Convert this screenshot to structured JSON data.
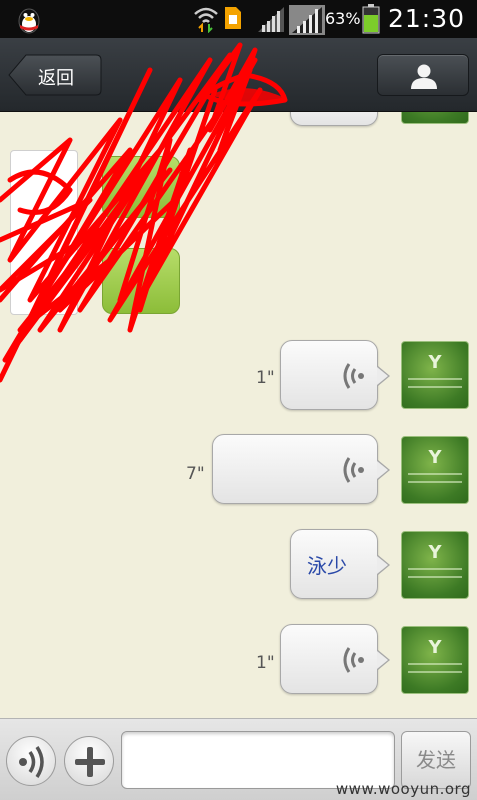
{
  "status_bar": {
    "battery_percent": "63%",
    "time": "21:30",
    "icons": [
      "qq-penguin-icon",
      "wifi-transfer-icon",
      "sim-card-icon",
      "signal-bars-icon",
      "signal-bars-full-icon",
      "battery-icon"
    ]
  },
  "header": {
    "back_label": "返回",
    "profile_icon": "person-icon"
  },
  "messages": [
    {
      "type": "voice",
      "duration": "1\""
    },
    {
      "type": "voice",
      "duration": "7\""
    },
    {
      "type": "text",
      "text": "泳少"
    },
    {
      "type": "voice",
      "duration": "1\""
    }
  ],
  "input_bar": {
    "voice_toggle_icon": "voice-toggle-icon",
    "plus_icon": "plus-icon",
    "message_value": "",
    "send_label": "发送"
  },
  "watermark": "www.wooyun.org",
  "colors": {
    "chat_background": "#f1efdc",
    "title_bar": "#2f3438",
    "avatar_green": "#4f8d2f",
    "scribble_red": "#ff0000"
  }
}
